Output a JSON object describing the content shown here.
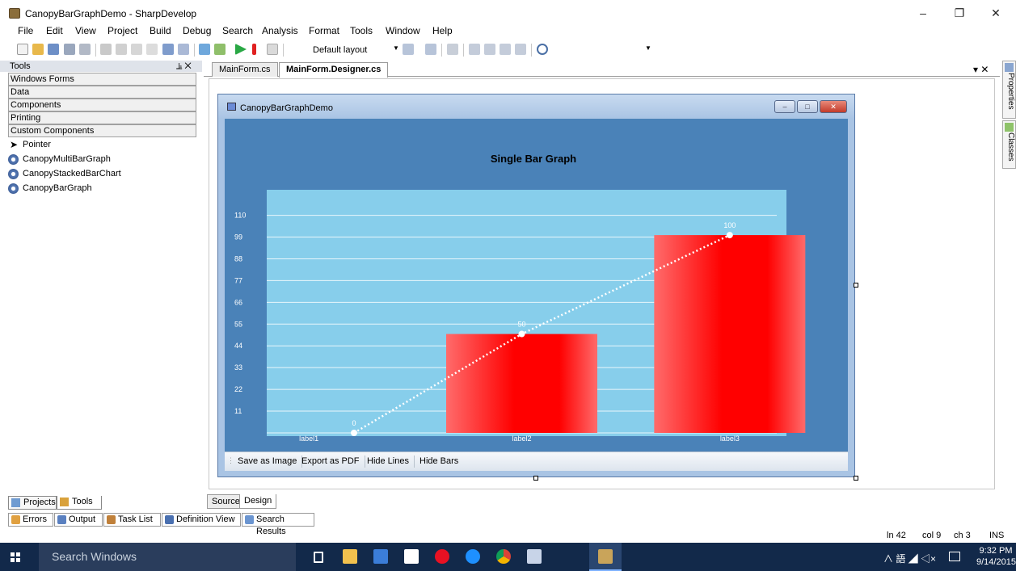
{
  "window": {
    "title": "CanopyBarGraphDemo - SharpDevelop",
    "controls": [
      "–",
      "❐",
      "✕"
    ]
  },
  "menu": [
    "File",
    "Edit",
    "View",
    "Project",
    "Build",
    "Debug",
    "Search",
    "Analysis",
    "Format",
    "Tools",
    "Window",
    "Help"
  ],
  "toolbar": {
    "layout_label": "Default layout"
  },
  "tools_panel": {
    "header": "Tools",
    "header_icons": "⫡ ✕",
    "categories": [
      "Windows Forms",
      "Data",
      "Components",
      "Printing",
      "Custom Components"
    ],
    "items": [
      "Pointer",
      "CanopyMultiBarGraph",
      "CanopyStackedBarChart",
      "CanopyBarGraph"
    ]
  },
  "left_tabs": [
    "Projects",
    "Tools"
  ],
  "doc_tabs": [
    "MainForm.cs",
    "MainForm.Designer.cs"
  ],
  "doc_controls": "▾ ✕",
  "form": {
    "title": "CanopyBarGraphDemo",
    "buttons": [
      "–",
      "□",
      "✕"
    ],
    "statusstrip": [
      "Save as Image",
      "Export as PDF",
      "Hide Lines",
      "Hide Bars"
    ]
  },
  "chart_data": {
    "type": "bar",
    "title": "Single Bar Graph",
    "categories": [
      "label1",
      "label2",
      "label3"
    ],
    "values": [
      0,
      50,
      100
    ],
    "data_labels": [
      "0",
      "50",
      "100"
    ],
    "yticks": [
      11,
      22,
      33,
      44,
      55,
      66,
      77,
      88,
      99,
      110
    ],
    "ylim": [
      0,
      118
    ],
    "grid": true,
    "overlay_line": "dotted",
    "colors": {
      "background": "#4a82b8",
      "plot": "#87ceeb",
      "bar": "#ff0000",
      "bar_light": "#ff6b6b",
      "text": "#ffffff",
      "grid": "#e8f6fb"
    }
  },
  "source_design": [
    "Source",
    "Design"
  ],
  "right_tabs": [
    "Properties",
    "Classes"
  ],
  "bottom_pads": [
    "Errors",
    "Output",
    "Task List",
    "Definition View",
    "Search Results"
  ],
  "status": {
    "line": "ln 42",
    "col": "col 9",
    "ch": "ch 3",
    "mode": "INS"
  },
  "taskbar": {
    "search_placeholder": "Search Windows",
    "time": "9:32 PM",
    "date": "9/14/2015",
    "tray": "∧ 語 ◢ ◁×"
  }
}
